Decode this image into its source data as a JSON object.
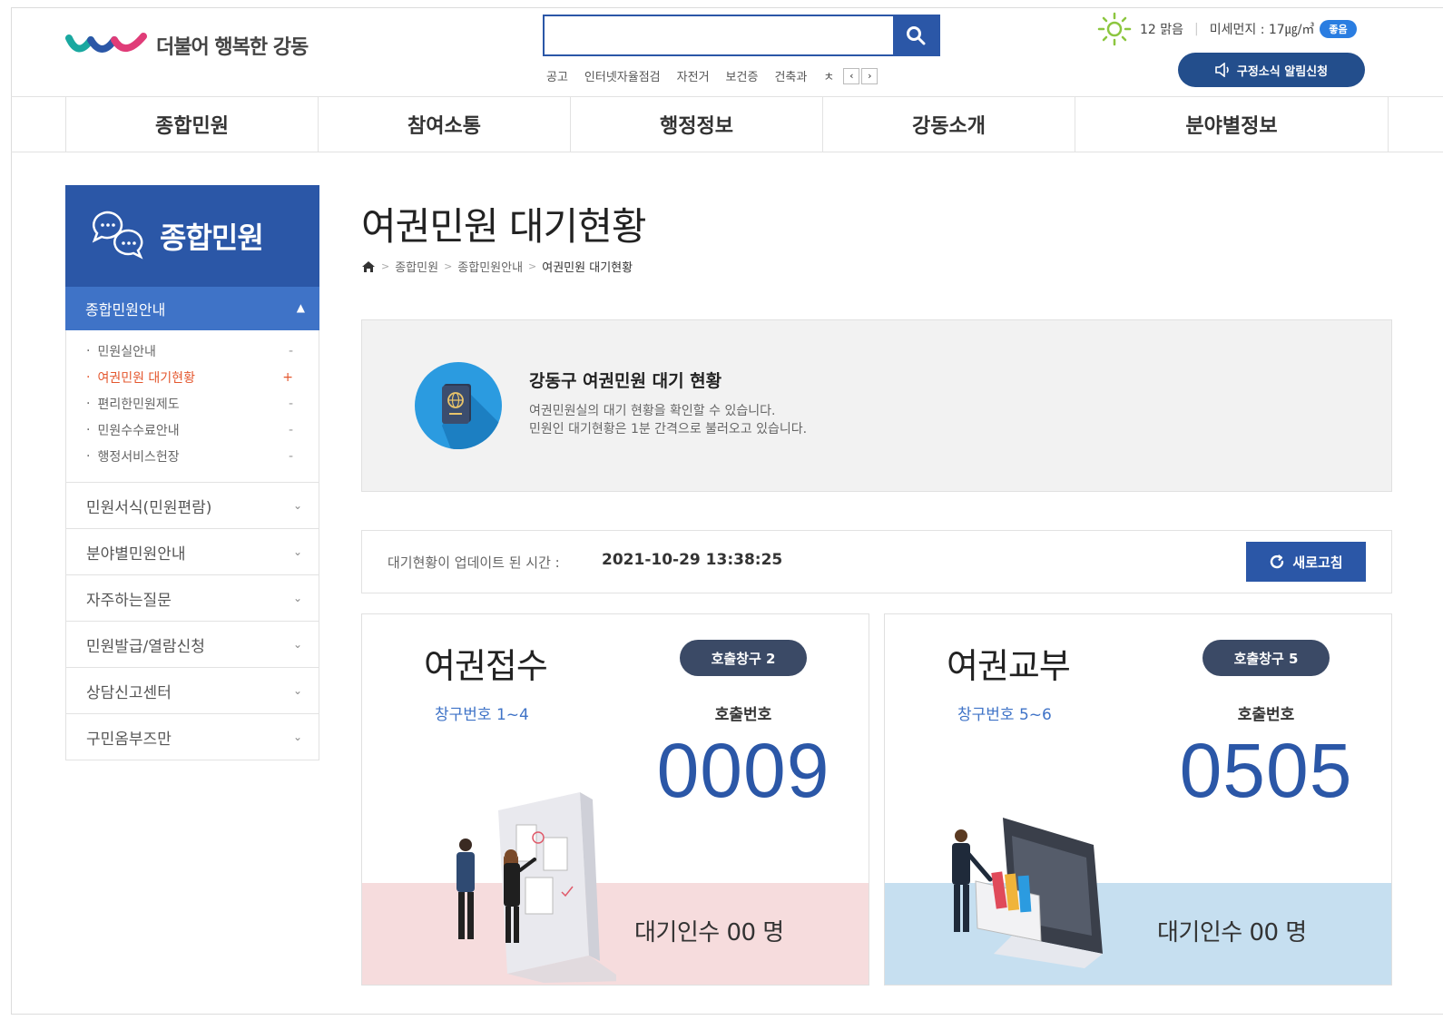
{
  "header": {
    "logo_text": "더불어 행복한 강동",
    "search_placeholder": "",
    "keywords": [
      "공고",
      "인터넷자율점검",
      "자전거",
      "보건증",
      "건축과",
      "ㅊ"
    ],
    "weather": {
      "temp": "12 맑음",
      "dust_label": "미세먼지 : 17㎍/㎥",
      "dust_badge": "좋음"
    },
    "alert_button": "구정소식 알림신청"
  },
  "gnb": [
    "종합민원",
    "참여소통",
    "행정정보",
    "강동소개",
    "분야별정보"
  ],
  "sidebar": {
    "title": "종합민원",
    "active_menu": "종합민원안내",
    "sub_items": [
      {
        "label": "민원실안내",
        "mark": "-"
      },
      {
        "label": "여권민원 대기현황",
        "mark": "+"
      },
      {
        "label": "편리한민원제도",
        "mark": "-"
      },
      {
        "label": "민원수수료안내",
        "mark": "-"
      },
      {
        "label": "행정서비스헌장",
        "mark": "-"
      }
    ],
    "menus": [
      "민원서식(민원편람)",
      "분야별민원안내",
      "자주하는질문",
      "민원발급/열람신청",
      "상담신고센터",
      "구민옴부즈만"
    ]
  },
  "main": {
    "title": "여권민원 대기현황",
    "breadcrumb": [
      "종합민원",
      "종합민원안내",
      "여권민원 대기현황"
    ],
    "info": {
      "title": "강동구 여권민원 대기 현황",
      "line1": "여권민원실의 대기 현황을 확인할 수 있습니다.",
      "line2": "민원인 대기현황은 1분 간격으로 불러오고 있습니다."
    },
    "update": {
      "label": "대기현황이 업데이트 된 시간 :",
      "time": "2021-10-29 13:38:25",
      "refresh": "새로고침"
    },
    "cards": [
      {
        "title": "여권접수",
        "window": "창구번호 1~4",
        "badge": "호출창구 2",
        "call_label": "호출번호",
        "number": "0009",
        "wait": "대기인수 00 명",
        "band_color": "#f6dcdd"
      },
      {
        "title": "여권교부",
        "window": "창구번호 5~6",
        "badge": "호출창구 5",
        "call_label": "호출번호",
        "number": "0505",
        "wait": "대기인수 00 명",
        "band_color": "#c6dff0"
      }
    ]
  },
  "colors": {
    "primary": "#2b57a7",
    "sidebar_active": "#3f73c7",
    "highlight": "#e4572e"
  }
}
